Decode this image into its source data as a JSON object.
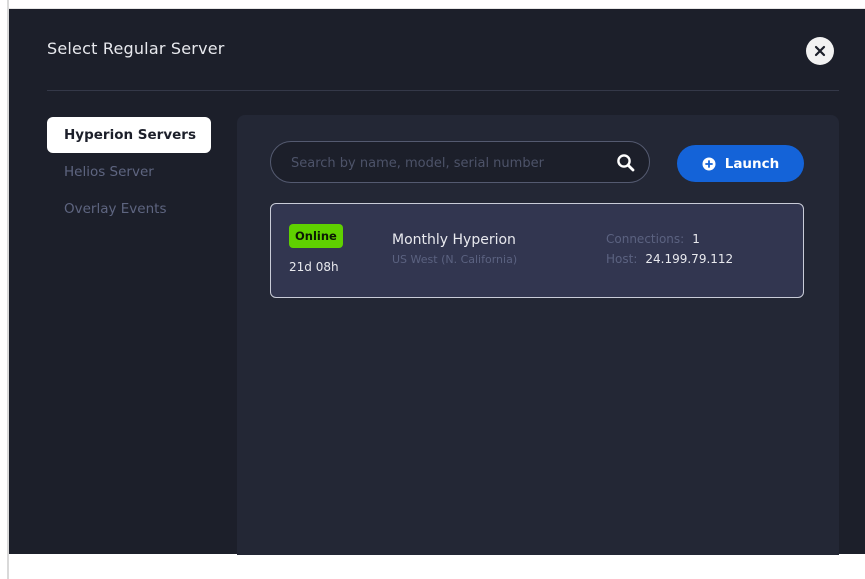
{
  "modal": {
    "title": "Select Regular Server"
  },
  "sidebar": {
    "items": [
      {
        "label": "Hyperion Servers",
        "active": true
      },
      {
        "label": "Helios Server",
        "active": false
      },
      {
        "label": "Overlay Events",
        "active": false
      }
    ]
  },
  "search": {
    "placeholder": "Search by name, model, serial number",
    "value": "",
    "icon": "search-icon"
  },
  "launch": {
    "label": "Launch",
    "icon": "plus-circle-icon"
  },
  "servers": [
    {
      "status": "Online",
      "uptime": "21d 08h",
      "name": "Monthly Hyperion",
      "region": "US West (N. California)",
      "connections_label": "Connections:",
      "connections_value": "1",
      "host_label": "Host:",
      "host_value": "24.199.79.112"
    }
  ],
  "colors": {
    "background": "#1c1f2a",
    "panel": "#232735",
    "card": "#323650",
    "accent": "#1463d8",
    "online": "#5fd100"
  }
}
